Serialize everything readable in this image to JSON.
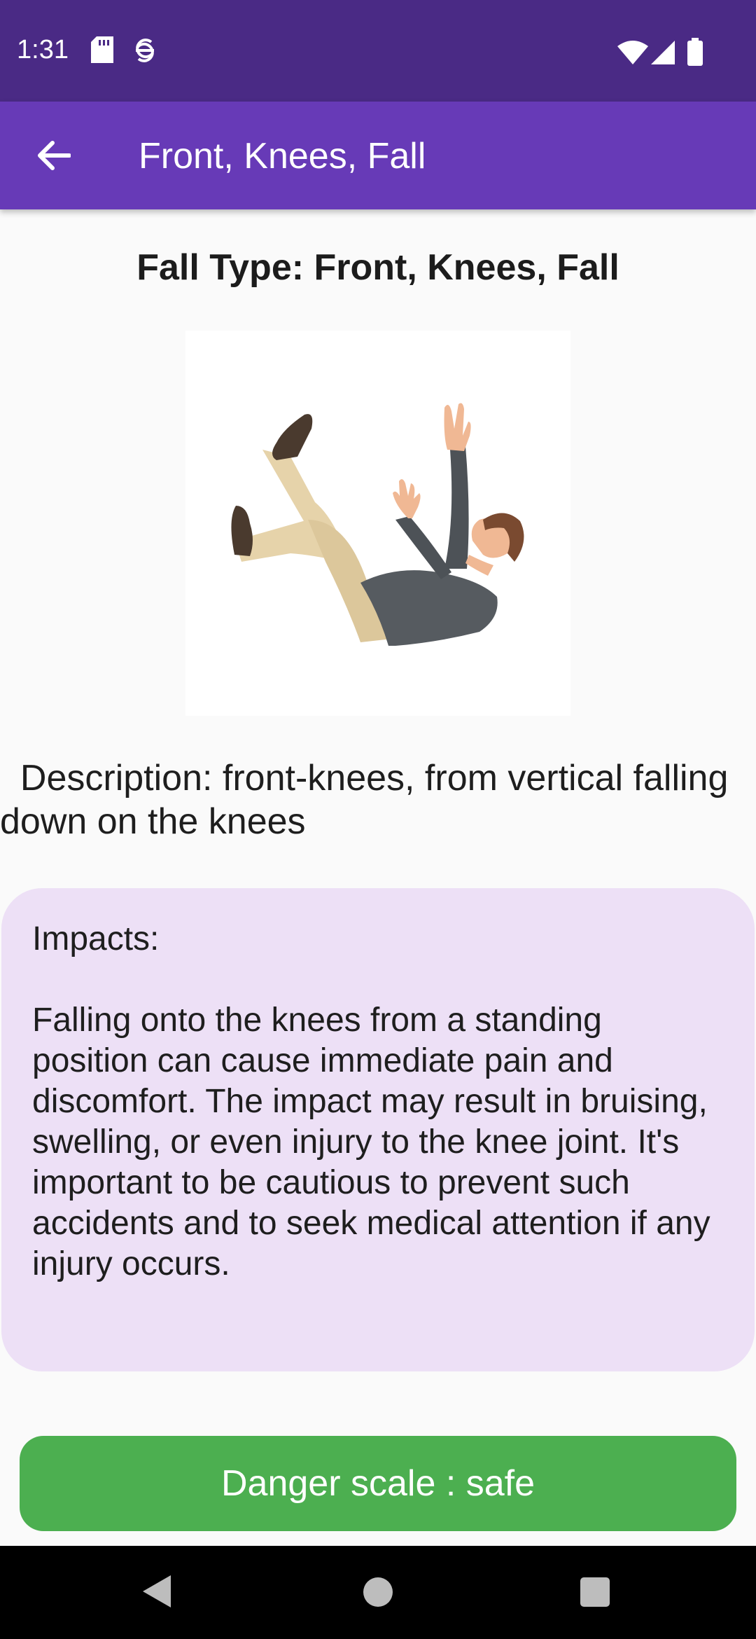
{
  "status_bar": {
    "time": "1:31",
    "icons": [
      "sd-card-icon",
      "sync-icon",
      "wifi-icon",
      "signal-icon",
      "battery-icon"
    ]
  },
  "app_bar": {
    "title": "Front, Knees, Fall",
    "back_icon": "arrow-back-icon"
  },
  "content": {
    "heading": "Fall Type: Front, Knees, Fall",
    "illustration": "falling-person-illustration",
    "description": "  Description: front-knees, from vertical falling down on the knees",
    "impacts_title": "Impacts:",
    "impacts_text": "Falling onto the knees from a standing position can cause immediate pain and discomfort. The impact may result in bruising, swelling, or even injury to the knee joint. It's important to be cautious to prevent such accidents and to seek medical attention if any injury occurs.",
    "danger_label": "Danger scale : safe"
  },
  "colors": {
    "status_bar": "#4a2a85",
    "app_bar": "#673ab7",
    "impacts_card": "#ede0f6",
    "danger_button": "#4caf50"
  },
  "nav_bar": {
    "icons": [
      "back-triangle-icon",
      "home-circle-icon",
      "recents-square-icon"
    ]
  }
}
